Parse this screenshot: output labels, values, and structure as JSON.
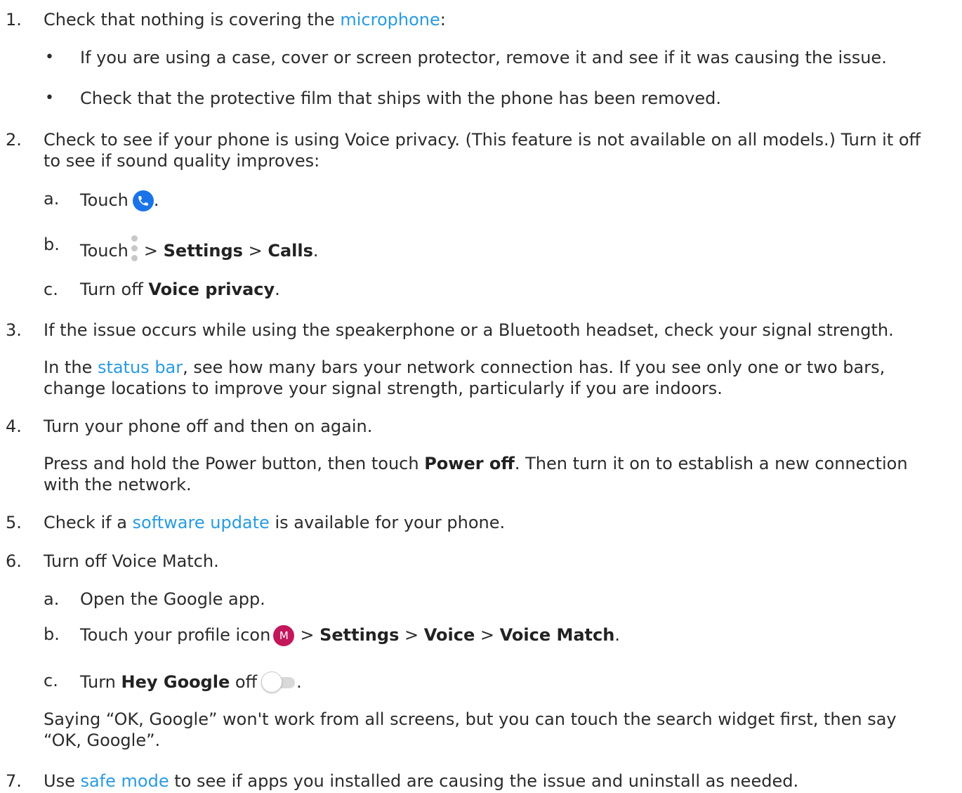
{
  "steps": [
    {
      "num": "1.",
      "text_before": "Check that nothing is covering the ",
      "link": "microphone",
      "text_after": ":",
      "bullets": [
        "If you are using a case, cover or screen protector, remove it and see if it was causing the issue.",
        "Check that the protective film that ships with the phone has been removed."
      ]
    },
    {
      "num": "2.",
      "line1": "Check to see if your phone is using Voice privacy. (This feature is not available on all models.) Turn it off",
      "line2": "to see if sound quality improves:",
      "subs": [
        {
          "label": "a.",
          "text_before": "Touch",
          "icon": "phone-icon",
          "text_after": "."
        },
        {
          "label": "b.",
          "text_before": "Touch",
          "icon": "more-vert-icon",
          "sep1": ">",
          "bold1": "Settings",
          "sep2": ">",
          "bold2": "Calls",
          "text_after": "."
        },
        {
          "label": "c.",
          "text_before": "Turn off ",
          "bold1": "Voice privacy",
          "text_after": "."
        }
      ]
    },
    {
      "num": "3.",
      "line1": "If the issue occurs while using the speakerphone or a Bluetooth headset, check your signal strength.",
      "para_before": "In the ",
      "para_link": "status bar",
      "para_after": ", see how many bars your network connection has. If you see only one or two bars,",
      "para_line2": "change locations to improve your signal strength, particularly if you are indoors."
    },
    {
      "num": "4.",
      "line1": "Turn your phone off and then on again.",
      "para_before": "Press and hold the Power button, then touch ",
      "para_bold": "Power off",
      "para_after": ". Then turn it on to establish a new connection",
      "para_line2": "with the network."
    },
    {
      "num": "5.",
      "text_before": "Check if a ",
      "link": "software update",
      "text_after": " is available for your phone."
    },
    {
      "num": "6.",
      "line1": "Turn off Voice Match.",
      "subs": [
        {
          "label": "a.",
          "text": "Open the Google app."
        },
        {
          "label": "b.",
          "text_before": "Touch your profile icon",
          "avatar_letter": "M",
          "sep1": ">",
          "bold1": "Settings",
          "sep2": ">",
          "bold2": "Voice",
          "sep3": ">",
          "bold3": "Voice Match",
          "text_after": "."
        },
        {
          "label": "c.",
          "text_before": "Turn ",
          "bold1": "Hey Google",
          "text_mid": " off",
          "icon": "toggle-off-icon",
          "text_after": "."
        }
      ],
      "note_line1": "Saying “OK, Google” won't work from all screens, but you can touch the search widget first, then say",
      "note_line2": "“OK, Google”."
    },
    {
      "num": "7.",
      "text_before": "Use ",
      "link": "safe mode",
      "text_after": " to see if apps you installed are causing the issue and uninstall as needed."
    }
  ],
  "colors": {
    "link": "#2a9be0",
    "text": "#2b2b2b",
    "phone_icon_bg": "#1a73e8",
    "avatar_bg": "#c2185b"
  }
}
